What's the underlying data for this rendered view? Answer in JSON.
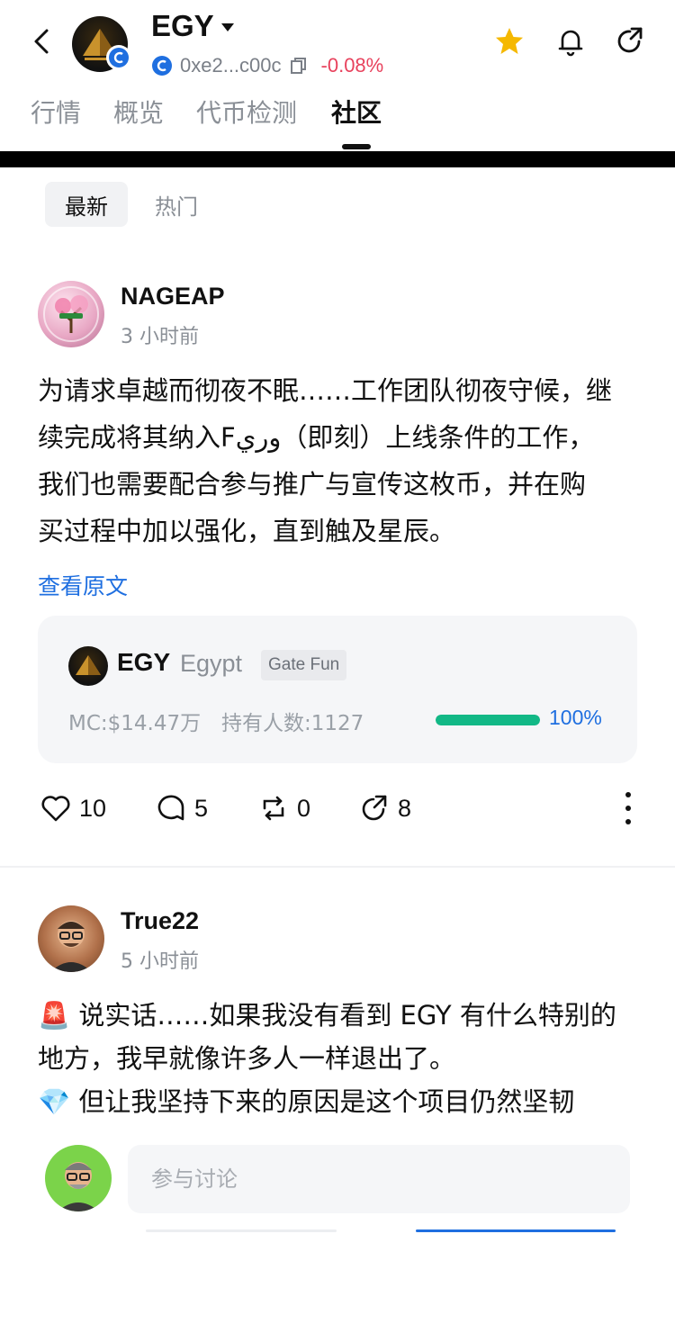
{
  "header": {
    "back_icon": "chevron-left-icon",
    "token_name": "EGY",
    "address": "0xe2...c00c",
    "change": "-0.08%",
    "change_color": "#e8425d",
    "icons": [
      "star-icon",
      "bell-icon",
      "share-icon"
    ],
    "star_color": "#f5b800"
  },
  "tabs": {
    "items": [
      {
        "label": "行情"
      },
      {
        "label": "概览"
      },
      {
        "label": "代币检测"
      },
      {
        "label": "社区"
      }
    ],
    "active": "社区"
  },
  "filters": {
    "new_label": "最新",
    "hot_label": "热门"
  },
  "posts": [
    {
      "username": "NAGEAP",
      "time": "3 小时前",
      "text_lines": [
        "为请求卓越而彻夜不眠……工作团队彻夜守候，继",
        "续完成将其纳入Fوري（即刻）上线条件的工作，",
        "我们也需要配合参与推广与宣传这枚币，并在购",
        "买过程中加以强化，直到触及星辰。"
      ],
      "view_original": "查看原文",
      "card": {
        "symbol": "EGY",
        "full_name": "Egypt",
        "tag": "Gate Fun",
        "market_cap": "MC:$14.47万",
        "holders": "持有人数:1127",
        "progress_label": "100%",
        "progress_fraction": 1.0,
        "progress_color": "#12b886"
      },
      "actions": {
        "likes": "10",
        "comments": "5",
        "reposts": "0",
        "shares": "8"
      }
    },
    {
      "username": "True22",
      "time": "5 小时前",
      "text_lines": [
        "🚨 说实话……如果我没有看到 EGY 有什么特别的",
        "地方，我早就像许多人一样退出了。",
        "💎 但让我坚持下来的原因是这个项目仍然坚韧"
      ]
    }
  ],
  "comment_bar": {
    "placeholder": "参与讨论"
  }
}
